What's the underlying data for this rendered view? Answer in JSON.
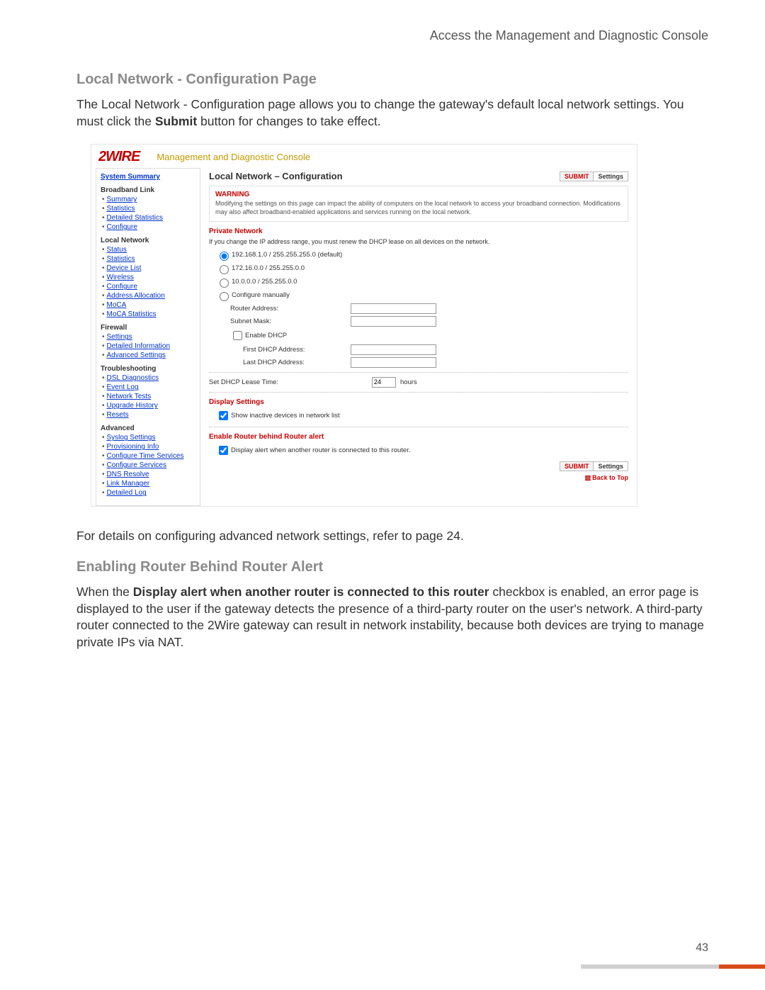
{
  "header": {
    "title": "Access the Management and Diagnostic Console"
  },
  "section1": {
    "heading": "Local Network - Configuration Page",
    "intro_pre": "The Local Network - Configuration page allows you to change the gateway's default local network settings. You must click the ",
    "intro_bold": "Submit",
    "intro_post": " button for changes to take effect."
  },
  "shot": {
    "brand": "2WIRE",
    "console": "Management and Diagnostic Console",
    "sidebar": {
      "top": "System Summary",
      "groups": [
        {
          "head": "Broadband Link",
          "items": [
            "Summary",
            "Statistics",
            "Detailed Statistics",
            "Configure"
          ]
        },
        {
          "head": "Local Network",
          "items": [
            "Status",
            "Statistics",
            "Device List",
            "Wireless",
            "Configure",
            "Address Allocation",
            "MoCA",
            "MoCA Statistics"
          ]
        },
        {
          "head": "Firewall",
          "items": [
            "Settings",
            "Detailed Information",
            "Advanced Settings"
          ]
        },
        {
          "head": "Troubleshooting",
          "items": [
            "DSL Diagnostics",
            "Event Log",
            "Network Tests",
            "Upgrade History",
            "Resets"
          ]
        },
        {
          "head": "Advanced",
          "items": [
            "Syslog Settings",
            "Provisioning Info",
            "Configure Time Services",
            "Configure Services",
            "DNS Resolve",
            "Link Manager",
            "Detailed Log"
          ]
        }
      ]
    },
    "main": {
      "title": "Local Network – Configuration",
      "submit": "SUBMIT",
      "settings": "Settings",
      "warning": {
        "title": "WARNING",
        "text": "Modifying the settings on this page can impact the ability of computers on the local network to access your broadband connection. Modifications may also affect broadband-enabled applications and services running on the local network."
      },
      "private": {
        "title": "Private Network",
        "note": "If you change the IP address range, you must renew the DHCP lease on all devices on the network.",
        "opt1": "192.168.1.0 / 255.255.255.0 (default)",
        "opt2": "172.16.0.0 / 255.255.0.0",
        "opt3": "10.0.0.0 / 255.255.0.0",
        "opt4": "Configure manually",
        "router_label": "Router Address:",
        "subnet_label": "Subnet Mask:",
        "enable_dhcp": "Enable DHCP",
        "first_dhcp": "First DHCP Address:",
        "last_dhcp": "Last DHCP Address:"
      },
      "lease": {
        "label": "Set DHCP Lease Time:",
        "value": "24",
        "unit": "hours"
      },
      "display": {
        "title": "Display Settings",
        "show_inactive": "Show inactive devices in network list"
      },
      "alert": {
        "title": "Enable Router behind Router alert",
        "text": "Display alert when another router is connected to this router."
      },
      "back_top": "Back to Top"
    }
  },
  "below": {
    "details": "For details on configuring advanced network settings, refer to page 24.",
    "heading2": "Enabling Router Behind Router Alert",
    "para_pre": "When the ",
    "para_bold": "Display alert when another router is connected to this router",
    "para_post": " checkbox is enabled, an error page is displayed to the user if the gateway detects the presence of a third-party router on the user's network. A third-party router connected to the 2Wire gateway can result in network instability, because both devices are trying to manage private IPs via NAT."
  },
  "page_number": "43"
}
